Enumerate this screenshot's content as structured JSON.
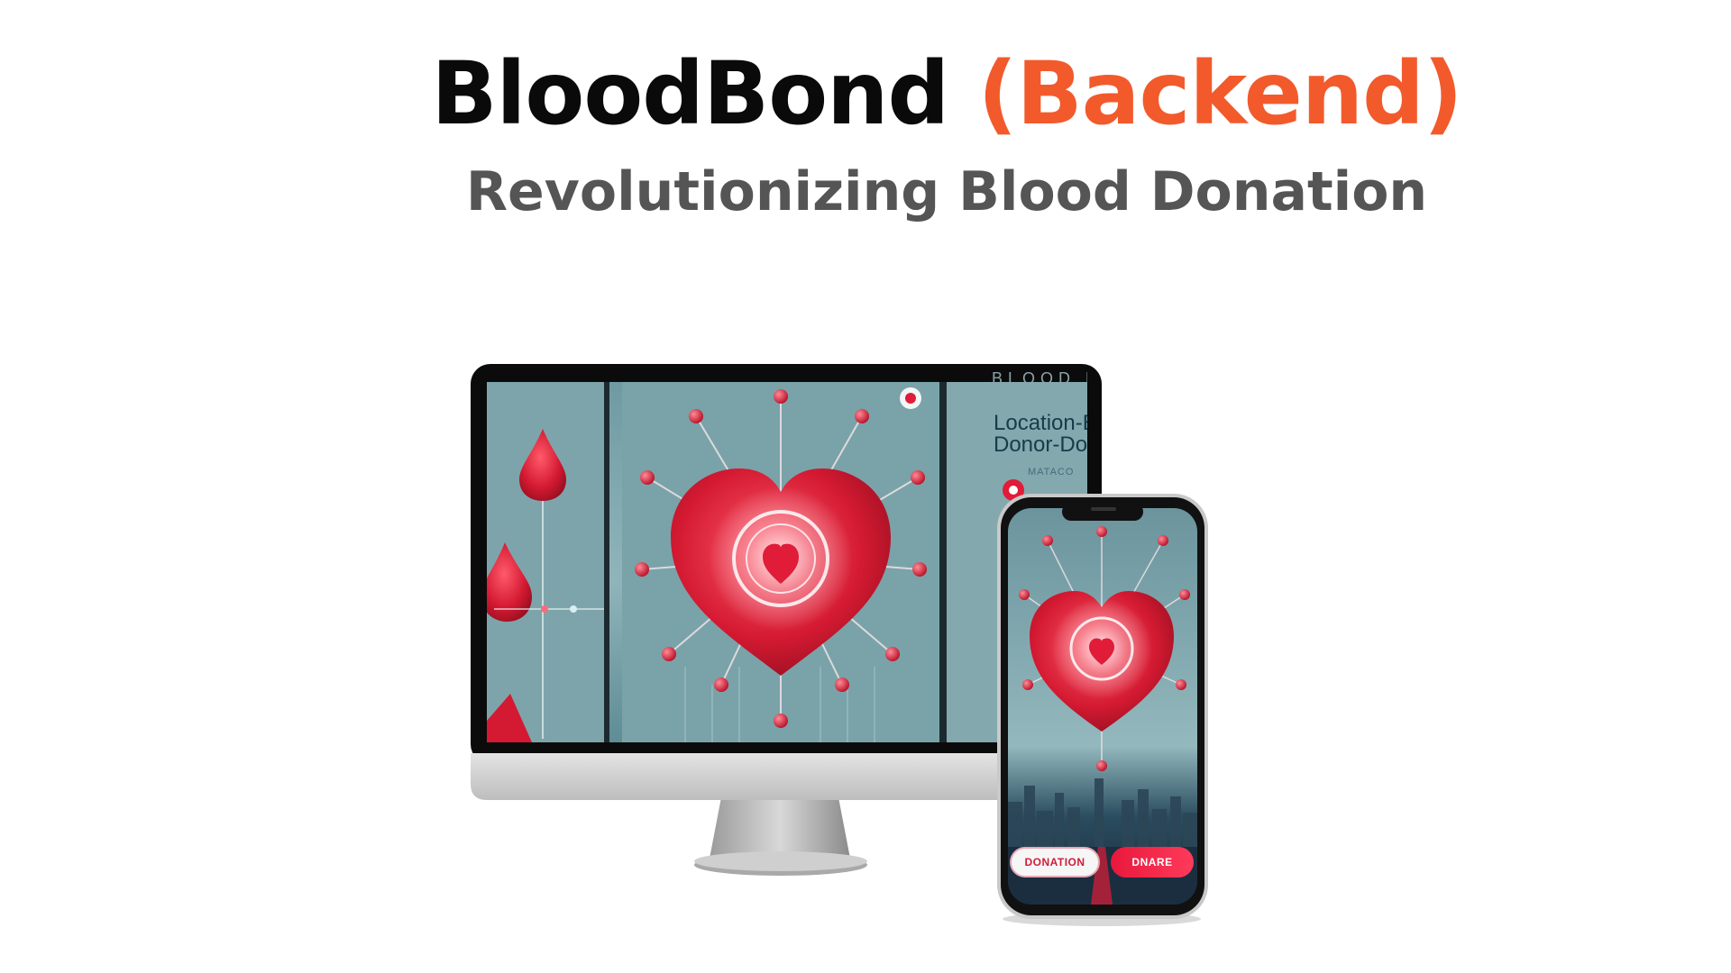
{
  "header": {
    "title_main": "BloodBond",
    "title_accent": "(Backend)",
    "subtitle": "Revolutionizing Blood Donation"
  },
  "desktop_screen": {
    "heading_partial": "BLOOD L",
    "feature_line1": "Location-Ba",
    "feature_line2": "Donor-Do",
    "small_label": "MATACO"
  },
  "phone_screen": {
    "button_left": "DONATION",
    "button_right": "DNARE"
  },
  "colors": {
    "accent": "#f25a2c",
    "blood_red": "#d41a32",
    "screen_bg": "#7fa6ad",
    "subtitle": "#555555"
  }
}
